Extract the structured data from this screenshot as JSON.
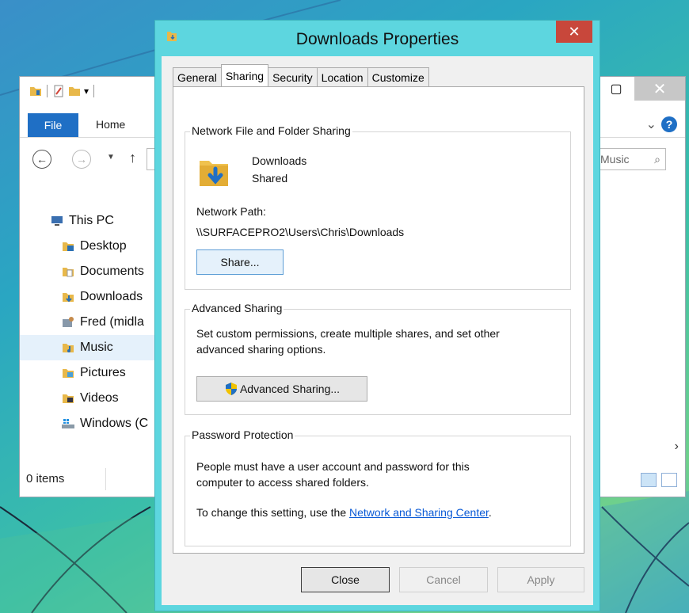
{
  "explorer": {
    "ribbon_tabs": {
      "file": "File",
      "home": "Home"
    },
    "search_placeholder": "Music",
    "nav_items": [
      {
        "label": "This PC",
        "icon": "this-pc-icon"
      },
      {
        "label": "Desktop",
        "icon": "desktop-folder-icon"
      },
      {
        "label": "Documents",
        "icon": "documents-folder-icon"
      },
      {
        "label": "Downloads",
        "icon": "downloads-folder-icon"
      },
      {
        "label": "Fred (midla",
        "icon": "network-user-icon"
      },
      {
        "label": "Music",
        "icon": "music-folder-icon",
        "selected": true
      },
      {
        "label": "Pictures",
        "icon": "pictures-folder-icon"
      },
      {
        "label": "Videos",
        "icon": "videos-folder-icon"
      },
      {
        "label": "Windows (C",
        "icon": "drive-icon"
      }
    ],
    "status": "0 items"
  },
  "dialog": {
    "title": "Downloads Properties",
    "tabs": [
      "General",
      "Sharing",
      "Security",
      "Location",
      "Customize"
    ],
    "active_tab": "Sharing",
    "network_sharing": {
      "group_label": "Network File and Folder Sharing",
      "folder_name": "Downloads",
      "folder_status": "Shared",
      "network_path_label": "Network Path:",
      "network_path": "\\\\SURFACEPRO2\\Users\\Chris\\Downloads",
      "share_button": "Share..."
    },
    "advanced_sharing": {
      "group_label": "Advanced Sharing",
      "description_line1": "Set custom permissions, create multiple shares, and set other",
      "description_line2": "advanced sharing options.",
      "button": "Advanced Sharing..."
    },
    "password_protection": {
      "group_label": "Password Protection",
      "line1": "People must have a user account and password for this",
      "line2": "computer to access shared folders.",
      "change_prefix": "To change this setting, use the ",
      "link": "Network and Sharing Center",
      "change_suffix": "."
    },
    "buttons": {
      "close": "Close",
      "cancel": "Cancel",
      "apply": "Apply"
    }
  },
  "colors": {
    "dialog_frame": "#5dd6df",
    "close_button": "#c8473b",
    "file_tab": "#1f6fc5",
    "link": "#0a5ad6"
  }
}
